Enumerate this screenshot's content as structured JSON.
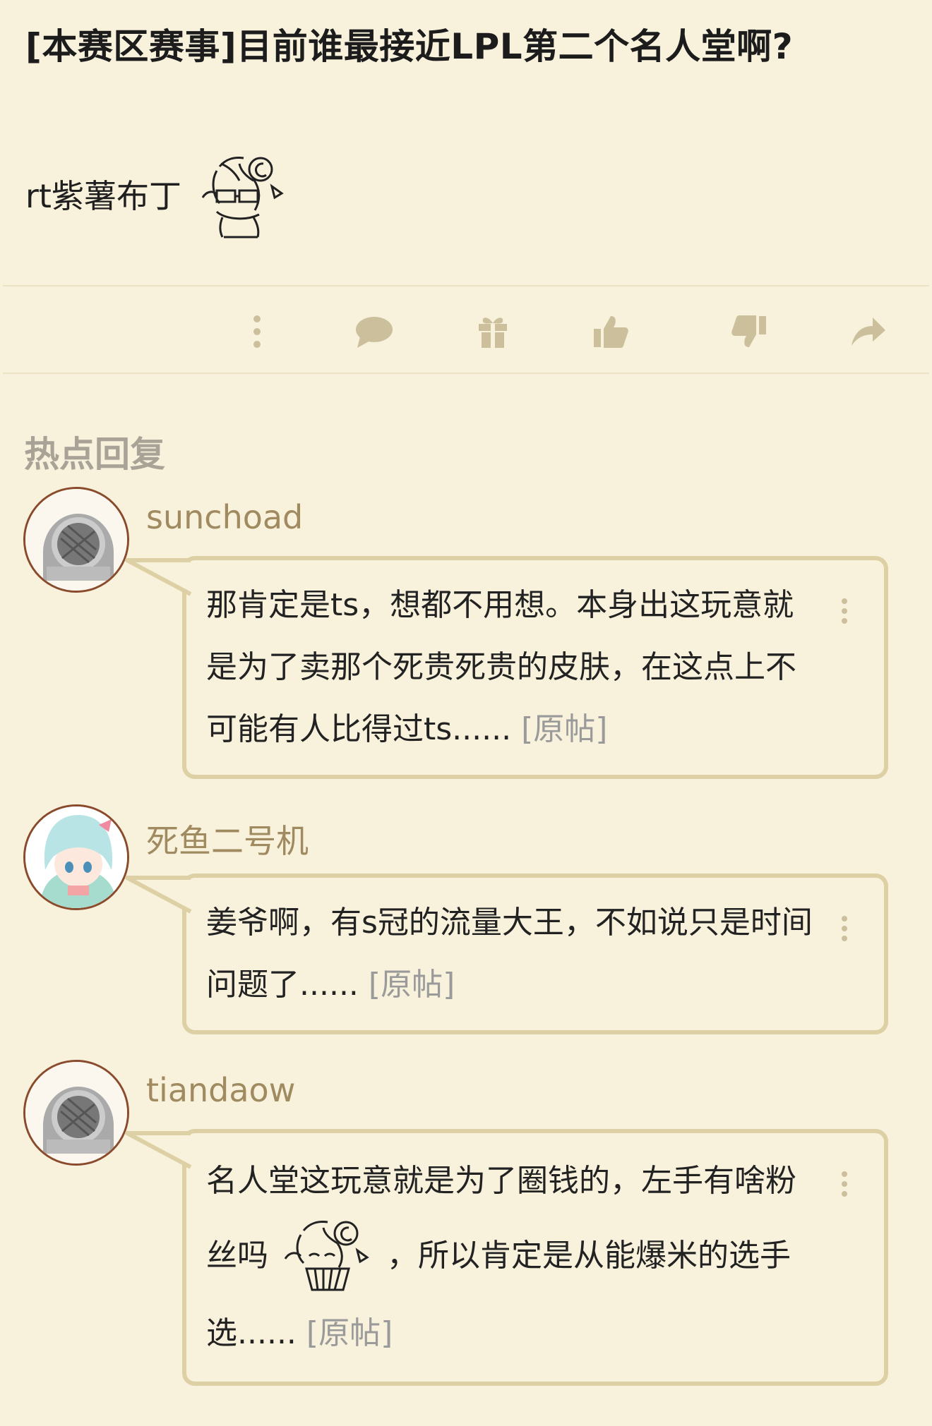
{
  "post": {
    "title": "[本赛区赛事]目前谁最接近LPL第二个名人堂啊?",
    "body_text": "rt紫薯布丁"
  },
  "actions": {
    "icons": [
      "more-icon",
      "comment-icon",
      "gift-icon",
      "thumbs-up-icon",
      "thumbs-down-icon",
      "share-icon"
    ]
  },
  "hot_replies": {
    "section_title": "热点回复",
    "replies": [
      {
        "username": "sunchoad",
        "text": "那肯定是ts，想都不用想。本身出这玩意就是为了卖那个死贵死贵的皮肤，在这点上不可能有人比得过ts......",
        "original_link": "[原帖]"
      },
      {
        "username": "死鱼二号机",
        "text": "姜爷啊，有s冠的流量大王，不如说只是时间问题了......",
        "original_link": "[原帖]"
      },
      {
        "username": "tiandaow",
        "text_before": "名人堂这玩意就是为了圈钱的，左手有啥粉丝吗",
        "text_after": "，所以肯定是从能爆米的选手选......",
        "original_link": "[原帖]"
      }
    ]
  },
  "colors": {
    "background": "#f8f1dc",
    "bubble_border": "#ddd0a4",
    "icon": "#cbbf9c",
    "username": "#a08a60"
  }
}
